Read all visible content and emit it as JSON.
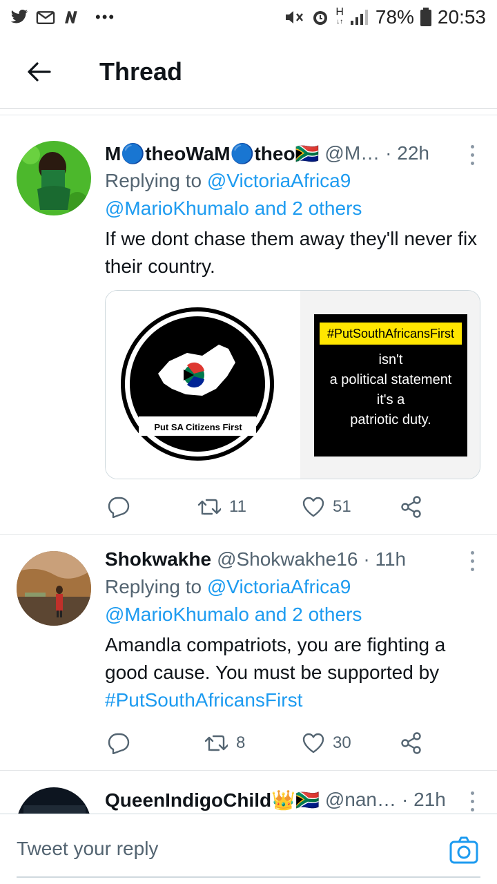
{
  "status_bar": {
    "battery": "78%",
    "time": "20:53",
    "network": "H"
  },
  "header": {
    "title": "Thread"
  },
  "tweets": [
    {
      "name": "M🔵theoWaM🔵theo🇿🇦",
      "handle": "@M…",
      "time": "· 22h",
      "replying_prefix": "Replying to ",
      "replying_to": "@VictoriaAfrica9",
      "replying_more": "@MarioKhumalo and 2 others",
      "text": "If we dont chase them away they'll never fix their country.",
      "media": {
        "left_caption": "Put SA Citizens First",
        "right_tag": "#PutSouthAfricansFirst",
        "right_lines": [
          "isn't",
          "a political statement",
          "it's a",
          "patriotic duty."
        ]
      },
      "retweets": "11",
      "likes": "51"
    },
    {
      "name": "Shokwakhe",
      "handle": "@Shokwakhe16",
      "time": "· 11h",
      "replying_prefix": "Replying to ",
      "replying_to": "@VictoriaAfrica9",
      "replying_more": "@MarioKhumalo and 2 others",
      "text": "Amandla compatriots, you are fighting a good cause. You must be supported by",
      "hashtag": "#PutSouthAfricansFirst",
      "retweets": "8",
      "likes": "30"
    },
    {
      "name": "QueenIndigoChild👑🇿🇦",
      "handle": "@nan…",
      "time": "· 21h"
    }
  ],
  "reply_bar": {
    "placeholder": "Tweet your reply"
  },
  "colors": {
    "link": "#1d9bf0",
    "secondary": "#536471"
  }
}
